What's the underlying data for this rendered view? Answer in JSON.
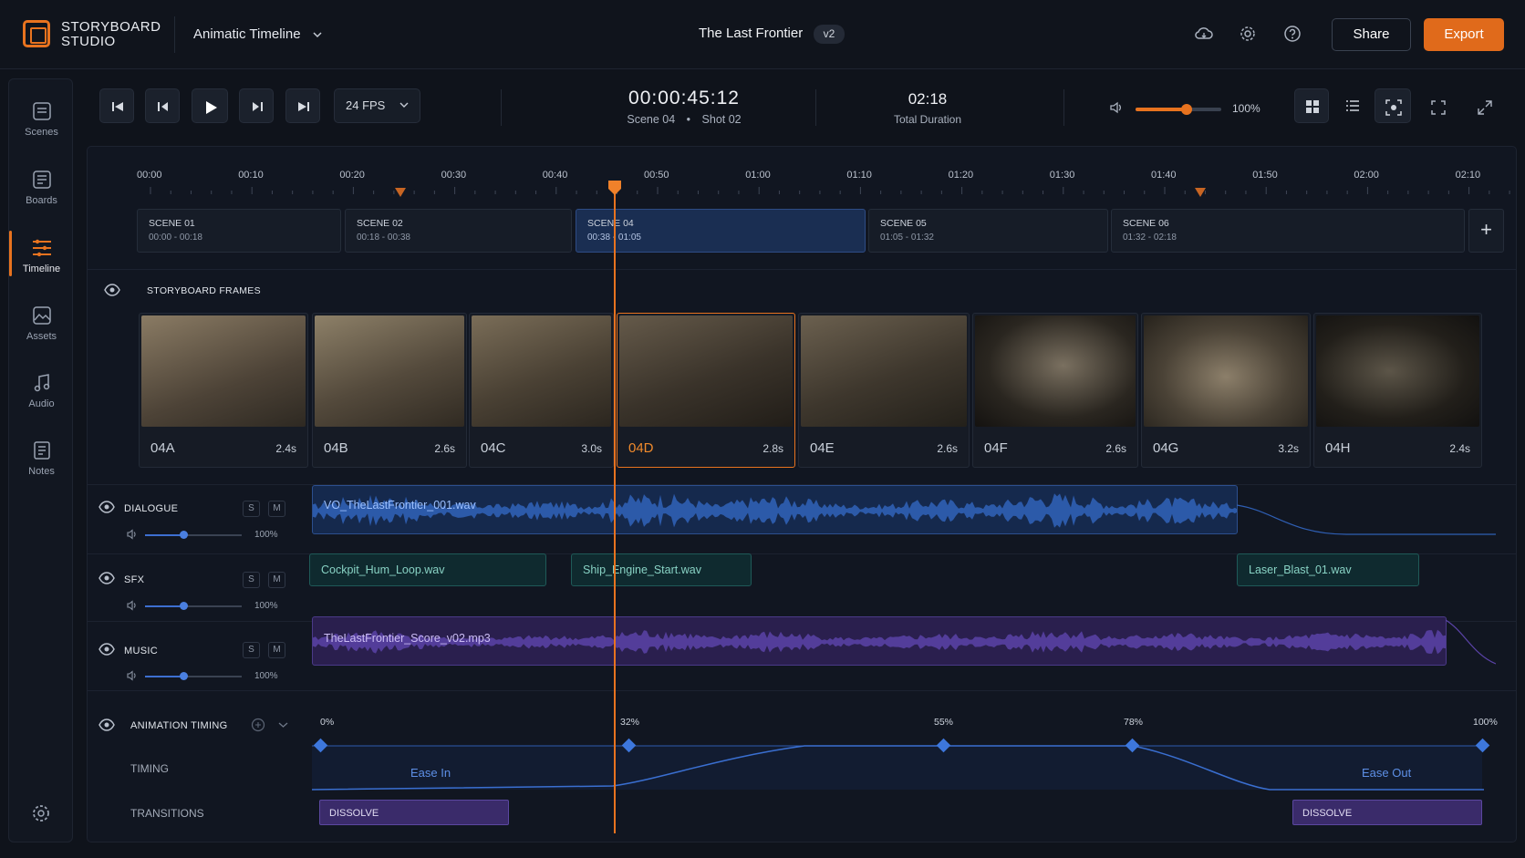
{
  "app": {
    "brand_line1": "STORYBOARD",
    "brand_line2": "STUDIO",
    "view_name": "Animatic Timeline",
    "project_title": "The Last Frontier",
    "version": "v2",
    "share_label": "Share",
    "export_label": "Export",
    "accent": "#e8731f"
  },
  "sidebar": {
    "items": [
      {
        "label": "Scenes"
      },
      {
        "label": "Boards"
      },
      {
        "label": "Timeline"
      },
      {
        "label": "Assets"
      },
      {
        "label": "Audio"
      },
      {
        "label": "Notes"
      }
    ],
    "active": "Timeline"
  },
  "transport": {
    "fps": "24 FPS",
    "timecode": "00:00:45:12",
    "scene": "Scene 04",
    "shot": "Shot 02",
    "total": "02:18",
    "total_label": "Total Duration",
    "volume": "100%",
    "volume_level": 0.6
  },
  "ruler": [
    "00:00",
    "00:10",
    "00:20",
    "00:30",
    "00:40",
    "00:50",
    "01:00",
    "01:10",
    "01:20",
    "01:30",
    "01:40",
    "01:50",
    "02:00",
    "02:10"
  ],
  "scenes": [
    {
      "name": "SCENE 01",
      "range": "00:00 - 00:18"
    },
    {
      "name": "SCENE 02",
      "range": "00:18 - 00:38"
    },
    {
      "name": "SCENE 04",
      "range": "00:38 - 01:05"
    },
    {
      "name": "SCENE 05",
      "range": "01:05 - 01:32"
    },
    {
      "name": "SCENE 06",
      "range": "01:32 - 02:18"
    }
  ],
  "frames_title": "STORYBOARD FRAMES",
  "frames": [
    {
      "id": "04A",
      "dur": "2.4s"
    },
    {
      "id": "04B",
      "dur": "2.6s"
    },
    {
      "id": "04C",
      "dur": "3.0s"
    },
    {
      "id": "04D",
      "dur": "2.8s"
    },
    {
      "id": "04E",
      "dur": "2.6s"
    },
    {
      "id": "04F",
      "dur": "2.6s"
    },
    {
      "id": "04G",
      "dur": "3.2s"
    },
    {
      "id": "04H",
      "dur": "2.4s"
    }
  ],
  "tracks": [
    {
      "name": "DIALOGUE",
      "volume": "100%",
      "level": 0.4,
      "solo": "S",
      "mute": "M"
    },
    {
      "name": "SFX",
      "volume": "100%",
      "level": 0.4,
      "solo": "S",
      "mute": "M"
    },
    {
      "name": "MUSIC",
      "volume": "100%",
      "level": 0.4,
      "solo": "S",
      "mute": "M"
    }
  ],
  "clips": {
    "dialogue": "VO_TheLastFrontier_001.wav",
    "sfx1": "Cockpit_Hum_Loop.wav",
    "sfx2": "Ship_Engine_Start.wav",
    "sfx3": "Laser_Blast_01.wav",
    "music": "TheLastFrontier_Score_v02.mp3"
  },
  "animation": {
    "title": "ANIMATION TIMING",
    "timing_label": "TIMING",
    "transitions_label": "TRANSITIONS",
    "keyframes": [
      "0%",
      "32%",
      "55%",
      "78%",
      "100%"
    ],
    "ease_in": "Ease In",
    "ease_out": "Ease Out",
    "transition1": "DISSOLVE",
    "transition2": "DISSOLVE"
  }
}
